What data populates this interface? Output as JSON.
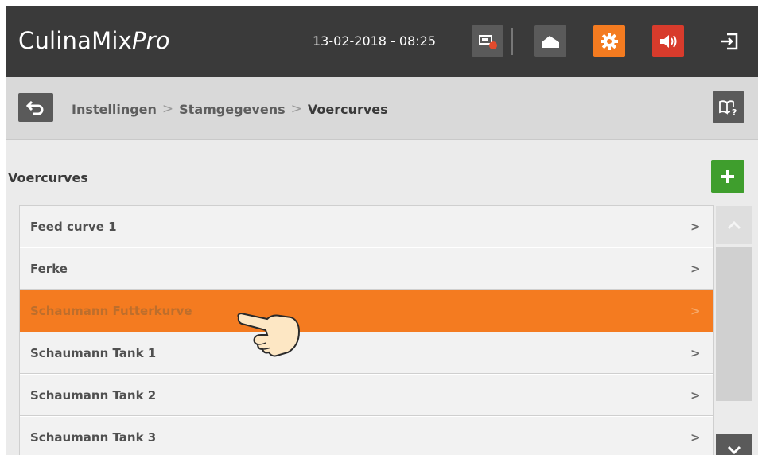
{
  "app": {
    "brand_main": "CulinaMix",
    "brand_italic": "Pro",
    "datetime": "13-02-2018 - 08:25"
  },
  "header_icons": [
    "screen-alarm-icon",
    "home-icon",
    "gear-icon",
    "speaker-icon",
    "logout-icon"
  ],
  "breadcrumb": {
    "items": [
      "Instellingen",
      "Stamgegevens",
      "Voercurves"
    ],
    "separator": ">"
  },
  "section": {
    "title": "Voercurves"
  },
  "list": {
    "items": [
      {
        "label": "Feed curve 1",
        "selected": false
      },
      {
        "label": "Ferke",
        "selected": false
      },
      {
        "label": "Schaumann Futterkurve",
        "selected": true
      },
      {
        "label": "Schaumann Tank 1",
        "selected": false
      },
      {
        "label": "Schaumann Tank 2",
        "selected": false
      },
      {
        "label": "Schaumann Tank 3",
        "selected": false
      }
    ],
    "chevron": ">"
  },
  "colors": {
    "header_bg": "#3a3a3a",
    "accent_orange": "#f47b20",
    "alarm_red": "#d83b2c",
    "add_green": "#3f9e2d"
  }
}
